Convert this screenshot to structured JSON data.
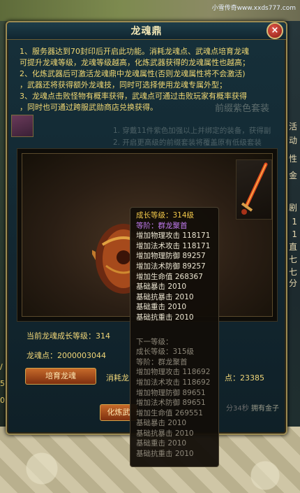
{
  "watermark": "小雪传奇www.xxds777.com",
  "window": {
    "title": "龙魂鼎",
    "close_label": "×"
  },
  "info_lines": [
    "1、服务器达到70封印后开启此功能。消耗龙魂点、武魂点培育龙魂",
    "可提升龙魂等级，龙魂等级越高，化炼武器获得的龙魂属性也越高；",
    "2、化炼武器后可激活龙魂鼎中龙魂属性(否则龙魂属性将不会激活)",
    "，武器还将获得额外龙魂技，同时可选择使用龙魂专属外型；",
    "3、龙魂点击败怪物有概率获得，武魂点可通过击败玩家有概率获得",
    "，同时也可通过跨服武勋商店兑换获得。"
  ],
  "behind": {
    "title": "前缀紫色套装",
    "lines": [
      "1. 穿戴11件紫色加强以上并绑定的装备，获得副",
      "2. 开启更高级的前缀套装将覆盖原有低级套装"
    ]
  },
  "right_strip": [
    "活",
    "动",
    "性",
    "金",
    "剧",
    "1",
    "1",
    "直",
    "七",
    "七",
    "分"
  ],
  "left_strip": [
    "/",
    "5",
    "0"
  ],
  "stats": {
    "cur_level_label": "当前龙魂成长等级：",
    "cur_level_value": "314",
    "soul_point_label": "龙魂点：",
    "soul_point_value": "2000003044",
    "consume_label": "消耗龙",
    "consume_value": "点：23385",
    "faint_timer": "分34秒",
    "faint_gold": "拥有金子"
  },
  "buttons": {
    "cultivate": "培育龙魂",
    "refine": "化炼武"
  },
  "tooltip": {
    "current": [
      {
        "label": "成长等级：",
        "value": "314级",
        "style": "hl"
      },
      {
        "label": "等阶：",
        "value": "群龙聚首",
        "style": "pu"
      },
      {
        "label": "增加物理攻击",
        "value": "118171",
        "style": ""
      },
      {
        "label": "增加法术攻击",
        "value": "118171",
        "style": ""
      },
      {
        "label": "增加物理防御",
        "value": "89257",
        "style": ""
      },
      {
        "label": "增加法术防御",
        "value": "89257",
        "style": ""
      },
      {
        "label": "增加生命值",
        "value": "268367",
        "style": ""
      },
      {
        "label": "基础暴击",
        "value": "2010",
        "style": ""
      },
      {
        "label": "基础抗暴击",
        "value": "2010",
        "style": ""
      },
      {
        "label": "基础重击",
        "value": "2010",
        "style": ""
      },
      {
        "label": "基础抗重击",
        "value": "2010",
        "style": ""
      }
    ],
    "next_title": "下一等级：",
    "next": [
      {
        "label": "成长等级：",
        "value": "315级"
      },
      {
        "label": "等阶：",
        "value": "群龙聚首"
      },
      {
        "label": "增加物理攻击",
        "value": "118692"
      },
      {
        "label": "增加法术攻击",
        "value": "118692"
      },
      {
        "label": "增加物理防御",
        "value": "89651"
      },
      {
        "label": "增加法术防御",
        "value": "89651"
      },
      {
        "label": "增加生命值",
        "value": "269551"
      },
      {
        "label": "基础暴击",
        "value": "2010"
      },
      {
        "label": "基础抗暴击",
        "value": "2010"
      },
      {
        "label": "基础重击",
        "value": "2010"
      },
      {
        "label": "基础抗重击",
        "value": "2010"
      }
    ]
  }
}
